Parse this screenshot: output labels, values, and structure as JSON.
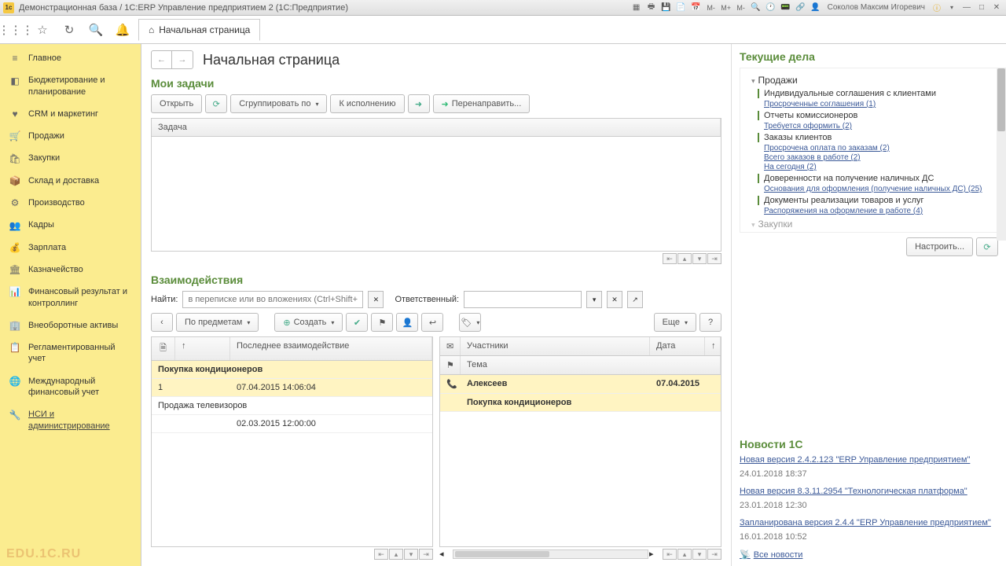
{
  "titlebar": {
    "title": "Демонстрационная база / 1C:ERP Управление предприятием 2  (1С:Предприятие)",
    "user": "Соколов Максим Игоревич"
  },
  "toolbar": {
    "home_tab": "Начальная страница"
  },
  "sidebar": {
    "items": [
      {
        "icon": "≡",
        "label": "Главное"
      },
      {
        "icon": "◧",
        "label": "Бюджетирование и планирование"
      },
      {
        "icon": "♥",
        "label": "CRM и маркетинг"
      },
      {
        "icon": "🛒",
        "label": "Продажи"
      },
      {
        "icon": "🛍",
        "label": "Закупки"
      },
      {
        "icon": "📦",
        "label": "Склад и доставка"
      },
      {
        "icon": "⚙",
        "label": "Производство"
      },
      {
        "icon": "👥",
        "label": "Кадры"
      },
      {
        "icon": "💰",
        "label": "Зарплата"
      },
      {
        "icon": "🏛",
        "label": "Казначейство"
      },
      {
        "icon": "📊",
        "label": "Финансовый результат и контроллинг"
      },
      {
        "icon": "🏢",
        "label": "Внеоборотные активы"
      },
      {
        "icon": "📋",
        "label": "Регламентированный учет"
      },
      {
        "icon": "🌐",
        "label": "Международный финансовый учет"
      },
      {
        "icon": "🔧",
        "label": "НСИ и администрирование"
      }
    ],
    "watermark": "EDU.1C.RU"
  },
  "page": {
    "title": "Начальная страница"
  },
  "tasks": {
    "title": "Мои задачи",
    "open": "Открыть",
    "group_by": "Сгруппировать по",
    "to_execution": "К исполнению",
    "redirect": "Перенаправить...",
    "header": "Задача"
  },
  "interactions": {
    "title": "Взаимодействия",
    "find_label": "Найти:",
    "find_placeholder": "в переписке или во вложениях (Ctrl+Shift+F)",
    "responsible_label": "Ответственный:",
    "by_subject": "По предметам",
    "create": "Создать",
    "more": "Еще",
    "left": {
      "col_icon": "",
      "col_sort": "↑",
      "col_last": "Последнее взаимодействие",
      "rows": [
        {
          "subject": "Покупка кондиционеров",
          "num": "1",
          "date": "07.04.2015 14:06:04",
          "highlight": true
        },
        {
          "subject": "Продажа телевизоров",
          "num": "",
          "date": "02.03.2015 12:00:00",
          "highlight": false
        }
      ]
    },
    "right": {
      "col_participants": "Участники",
      "col_date": "Дата",
      "col_subject": "Тема",
      "col_sort": "↑",
      "rows": [
        {
          "participant": "Алексеев",
          "date": "07.04.2015",
          "subject": "Покупка кондиционеров"
        }
      ]
    }
  },
  "current": {
    "title": "Текущие дела",
    "group": "Продажи",
    "items": [
      {
        "label": "Индивидуальные соглашения с клиентами",
        "links": [
          "Просроченные соглашения (1)"
        ]
      },
      {
        "label": "Отчеты комиссионеров",
        "links": [
          "Требуется оформить (2)"
        ]
      },
      {
        "label": "Заказы клиентов",
        "links": [
          "Просрочена оплата по заказам (2)",
          "Всего заказов в работе (2)",
          "На сегодня (2)"
        ]
      },
      {
        "label": "Доверенности на получение наличных ДС",
        "links": [
          "Основания для оформления (получение наличных ДС) (25)"
        ]
      },
      {
        "label": "Документы реализации товаров и услуг",
        "links": [
          "Распоряжения на оформление в работе (4)"
        ]
      }
    ],
    "next_group": "Закупки",
    "configure": "Настроить..."
  },
  "news": {
    "title": "Новости 1С",
    "items": [
      {
        "link": "Новая версия 2.4.2.123 \"ERP Управление предприятием\"",
        "date": "24.01.2018 18:37"
      },
      {
        "link": "Новая версия 8.3.11.2954 \"Технологическая платформа\"",
        "date": "23.01.2018 12:30"
      },
      {
        "link": "Запланирована версия 2.4.4 \"ERP Управление предприятием\"",
        "date": "16.01.2018 10:52"
      }
    ],
    "all": "Все новости"
  }
}
